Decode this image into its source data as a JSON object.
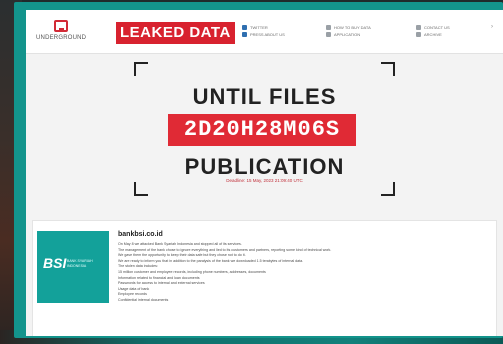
{
  "header": {
    "logo_text": "UNDERGROUND",
    "logo_badge": "",
    "title": "LEAKED DATA",
    "nav": {
      "col1": [
        "TWITTER",
        "PRESS ABOUT US"
      ],
      "col2": [
        "HOW TO BUY DATA",
        "APPLICATION"
      ],
      "col3": [
        "CONTACT US",
        "ARCHIVE"
      ]
    }
  },
  "countdown": {
    "line1": "UNTIL FILES",
    "timer": "2D20H28M06S",
    "line2": "PUBLICATION",
    "deadline": "Deadline: 15 May, 2023 21:09:40 UTC"
  },
  "card": {
    "logo_text": "BSI",
    "logo_sub": "BANK SYARIAH INDONESIA",
    "title": "bankbsi.co.id",
    "lines": [
      "On May 8 we attacked Bank Syariah Indonesia and stopped all of its services.",
      "The management of the bank chose to ignore everything and lied to its customers and partners, reporting some kind of technical work.",
      "We gave them the opportunity to keep their data safe but they chose not to do it.",
      "We are ready to inform you that in addition to the paralysis of the bank we downloaded 1.5 terabytes of internal data.",
      "The stolen data includes:",
      "15 million customer and employee records, including phone numbers, addresses, documents",
      "Information related to financial and loan documents",
      "Passwords for access to internal and external services",
      "Usage data of bank",
      "Employee records",
      "Confidential internal documents"
    ]
  }
}
